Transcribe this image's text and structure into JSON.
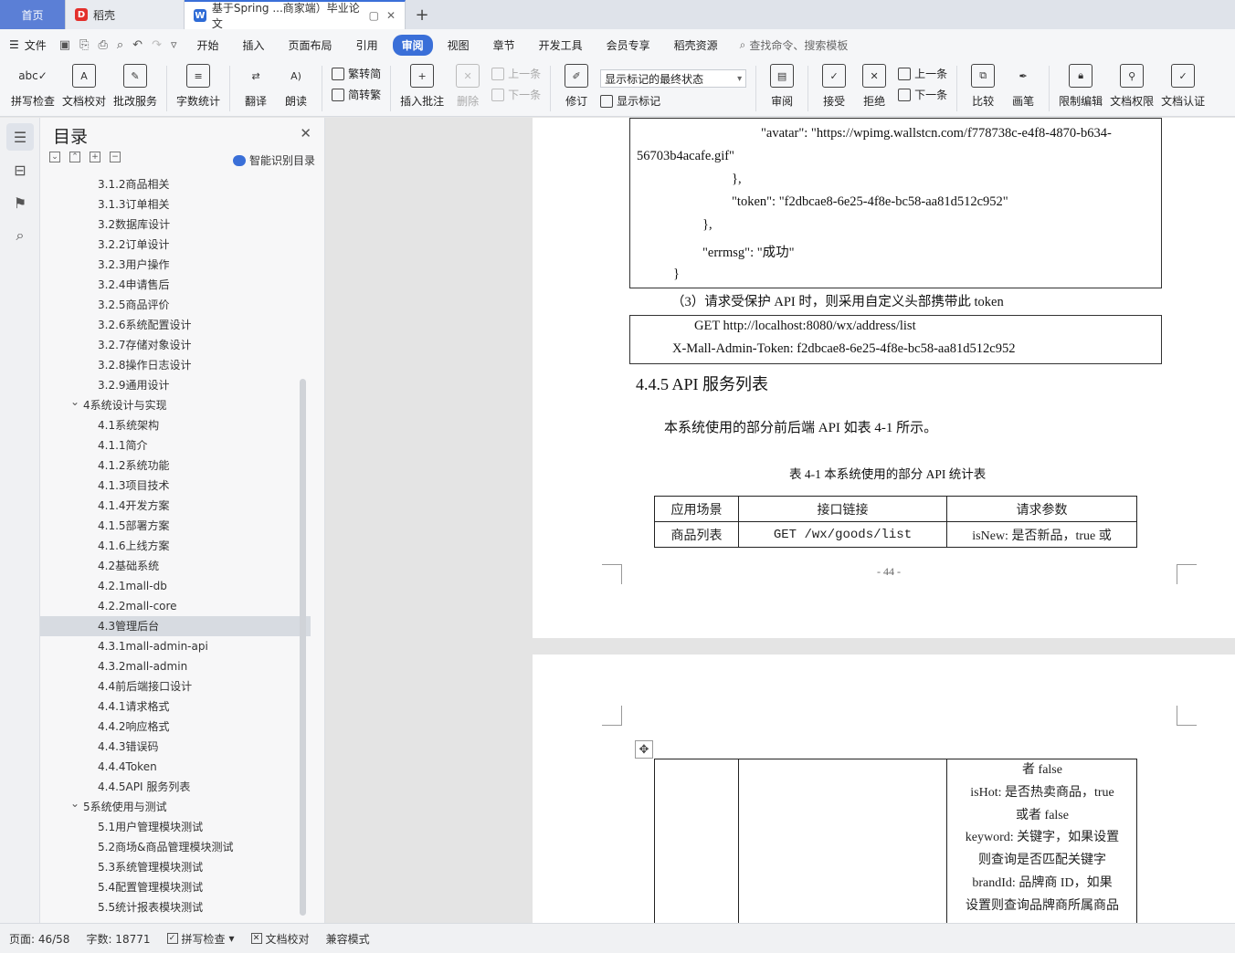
{
  "tabs": {
    "home": "首页",
    "daoke": "稻壳",
    "doc": "基于Spring ...商家端）毕业论文"
  },
  "menu": {
    "file": "文件",
    "items": [
      "开始",
      "插入",
      "页面布局",
      "引用",
      "审阅",
      "视图",
      "章节",
      "开发工具",
      "会员专享",
      "稻壳资源"
    ],
    "active": "审阅",
    "search": "查找命令、搜索模板"
  },
  "ribbon": {
    "spell": "拼写检查",
    "proofread": "文档校对",
    "review_service": "批改服务",
    "word_count": "字数统计",
    "translate": "翻译",
    "read_aloud": "朗读",
    "trad_to_simp": "繁转简",
    "simp_to_trad": "简转繁",
    "insert_comment": "插入批注",
    "delete": "删除",
    "prev_comment": "上一条",
    "next_comment": "下一条",
    "revise": "修订",
    "markup_state": "显示标记的最终状态",
    "show_markup": "显示标记",
    "review": "审阅",
    "accept": "接受",
    "reject": "拒绝",
    "prev_change": "上一条",
    "next_change": "下一条",
    "compare": "比较",
    "pen": "画笔",
    "restrict_edit": "限制编辑",
    "doc_permission": "文档权限",
    "doc_cert": "文档认证"
  },
  "toc": {
    "title": "目录",
    "smart": "智能识别目录",
    "items": [
      {
        "label": "3.1.2商品相关",
        "level": 2
      },
      {
        "label": "3.1.3订单相关",
        "level": 2
      },
      {
        "label": "3.2数据库设计",
        "level": 2
      },
      {
        "label": "3.2.2订单设计",
        "level": 2
      },
      {
        "label": "3.2.3用户操作",
        "level": 2
      },
      {
        "label": "3.2.4申请售后",
        "level": 2
      },
      {
        "label": "3.2.5商品评价",
        "level": 2
      },
      {
        "label": "3.2.6系统配置设计",
        "level": 2
      },
      {
        "label": "3.2.7存储对象设计",
        "level": 2
      },
      {
        "label": "3.2.8操作日志设计",
        "level": 2
      },
      {
        "label": "3.2.9通用设计",
        "level": 2
      },
      {
        "label": "4系统设计与实现",
        "level": 1
      },
      {
        "label": "4.1系统架构",
        "level": 2
      },
      {
        "label": "4.1.1简介",
        "level": 2
      },
      {
        "label": "4.1.2系统功能",
        "level": 2
      },
      {
        "label": "4.1.3项目技术",
        "level": 2
      },
      {
        "label": "4.1.4开发方案",
        "level": 2
      },
      {
        "label": "4.1.5部署方案",
        "level": 2
      },
      {
        "label": "4.1.6上线方案",
        "level": 2
      },
      {
        "label": "4.2基础系统",
        "level": 2
      },
      {
        "label": "4.2.1mall-db",
        "level": 2
      },
      {
        "label": "4.2.2mall-core",
        "level": 2
      },
      {
        "label": "4.3管理后台",
        "level": 2,
        "selected": true
      },
      {
        "label": "4.3.1mall-admin-api",
        "level": 2
      },
      {
        "label": "4.3.2mall-admin",
        "level": 2
      },
      {
        "label": "4.4前后端接口设计",
        "level": 2
      },
      {
        "label": "4.4.1请求格式",
        "level": 2
      },
      {
        "label": "4.4.2响应格式",
        "level": 2
      },
      {
        "label": "4.4.3错误码",
        "level": 2
      },
      {
        "label": "4.4.4Token",
        "level": 2
      },
      {
        "label": "4.4.5API 服务列表",
        "level": 2
      },
      {
        "label": "5系统使用与测试",
        "level": 1
      },
      {
        "label": "5.1用户管理模块测试",
        "level": 2
      },
      {
        "label": "5.2商场&商品管理模块测试",
        "level": 2
      },
      {
        "label": "5.3系统管理模块测试",
        "level": 2
      },
      {
        "label": "5.4配置管理模块测试",
        "level": 2
      },
      {
        "label": "5.5统计报表模块测试",
        "level": 2
      }
    ]
  },
  "document": {
    "code1": {
      "line1": "\"avatar\": \"https://wpimg.wallstcn.com/f778738c-e4f8-4870-b634-",
      "line2": "56703b4acafe.gif\"",
      "line3": "},",
      "line4": "\"token\": \"f2dbcae8-6e25-4f8e-bc58-aa81d512c952\"",
      "line5": "},",
      "line6": "\"errmsg\": \"成功\"",
      "line7": "}"
    },
    "para_protected": "（3）请求受保护 API 时，则采用自定义头部携带此 token",
    "code2": {
      "line1": "GET http://localhost:8080/wx/address/list",
      "line2": "X-Mall-Admin-Token: f2dbcae8-6e25-4f8e-bc58-aa81d512c952"
    },
    "heading": "4.4.5 API 服务列表",
    "para_intro": "本系统使用的部分前后端 API 如表 4-1 所示。",
    "table_caption": "表 4-1 本系统使用的部分 API 统计表",
    "table_headers": [
      "应用场景",
      "接口链接",
      "请求参数"
    ],
    "table_row1": [
      "商品列表",
      "GET /wx/goods/list",
      "isNew: 是否新品，true 或"
    ],
    "page_number": "- 44 -",
    "cont_lines": [
      "者 false",
      "isHot: 是否热卖商品，true",
      "或者 false",
      "keyword: 关键字，如果设置",
      "则查询是否匹配关键字",
      "brandId: 品牌商 ID，如果",
      "设置则查询品牌商所属商品"
    ]
  },
  "status": {
    "page": "页面: 46/58",
    "words": "字数: 18771",
    "spell": "拼写检查",
    "proof": "文档校对",
    "compat": "兼容模式"
  }
}
